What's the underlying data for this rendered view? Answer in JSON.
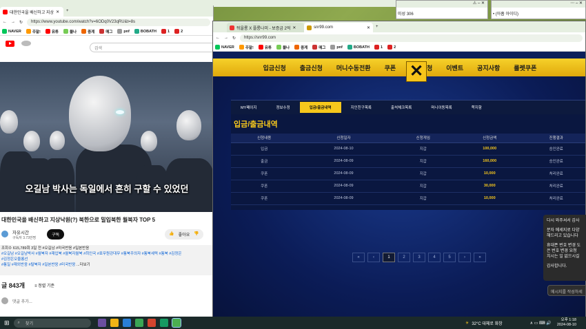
{
  "left_window": {
    "tab_title": "대한민국을 배신하고 지상",
    "url": "https://www.youtube.com/watch?v=6ODq0V23qRU&t=8s",
    "bookmarks": [
      "NAVER",
      "주말!",
      "유튜",
      "블나",
      "중계",
      "매그",
      "pnf",
      "BOBATH",
      "1",
      "2"
    ],
    "search_placeholder": "검색",
    "video_caption": "오길남 박사는 독일에서 흔히 구할 수 있었던",
    "video_title": "대한민국을 배신하고 지상낙원(?) 북한으로 밀입북한 월북자 TOP 5",
    "channel_name": "자유시간",
    "subscribers": "구독자 3.73만명",
    "subscribe_label": "구독",
    "like_label": "좋아요",
    "desc_line1": "조회수 615,789회  3일 전  #오길남 #미국반응 #일본반응",
    "desc_line2": "#오길남 #오길남박사 #월북자 #재입북 #월북자월북 #최인국 #표무원강대무 #통북주의자 #통북세력 #통북 #김정은",
    "desc_line3": "#김정은오율롱선",
    "desc_line4": "#통일 #재외반응 #탈북자 #일본반응 #미국반응",
    "desc_more": "...더보기",
    "comments_count": "글 843개",
    "sort_label": "정렬 기준",
    "comment_placeholder": "댓글 추가..."
  },
  "small_windows": {
    "s1_text": "미성 306",
    "s2_text": "• (아홉 아이디)"
  },
  "right_window": {
    "tab1": "뒤을룡 X 플롱나미 - 보증금 2억",
    "tab2": "snr99.com",
    "url": "https://snr99.com",
    "bookmarks": [
      "NAVER",
      "주말!",
      "유튜",
      "블나",
      "중계",
      "매그",
      "pnf",
      "BOBATH",
      "1",
      "2"
    ],
    "top_nav": [
      "입금신청",
      "출금신청",
      "머니수동전환",
      "쿠폰",
      "콤프신청",
      "이벤트",
      "공지사항",
      "룰렛쿠폰"
    ],
    "sub_nav": [
      "MY페이지",
      "정보수정",
      "입금/출금내역",
      "지인친구목록",
      "출석체크목록",
      "머니이동목록",
      "쪽지함"
    ],
    "active_sub": 2,
    "page_title": "입금/출금내역",
    "table": {
      "headers": [
        "신청내용",
        "신청일자",
        "신청게임",
        "신청금액",
        "진행결과"
      ],
      "rows": [
        [
          "입금",
          "2024-08-10",
          "지갑",
          "100,000",
          "승인완료"
        ],
        [
          "출금",
          "2024-08-09",
          "지갑",
          "160,000",
          "승인완료"
        ],
        [
          "쿠폰",
          "2024-08-09",
          "지갑",
          "10,000",
          "처리완료"
        ],
        [
          "쿠폰",
          "2024-08-09",
          "지갑",
          "30,000",
          "처리완료"
        ],
        [
          "쿠폰",
          "2024-08-09",
          "지갑",
          "10,000",
          "처리완료"
        ]
      ]
    },
    "pager": [
      "«",
      "‹",
      "1",
      "2",
      "3",
      "4",
      "5",
      "›",
      "»"
    ],
    "pager_current": "1"
  },
  "chat": {
    "line1": "다시 와주셔서 감사",
    "line2": "분자 메세지로 다양",
    "line3": "해드리고 있습니다",
    "line4": "휴대폰 번호 변경 도",
    "line5": "은 번호 변경 요청",
    "line6": "치시는 일 없으시길",
    "line7": "감사합니다.",
    "input_placeholder": "메시지를 작성하세"
  },
  "taskbar": {
    "search_label": "찾기",
    "weather": "32°C  대체로 화창",
    "time": "오후 1:18",
    "date": "2024-08-10"
  }
}
